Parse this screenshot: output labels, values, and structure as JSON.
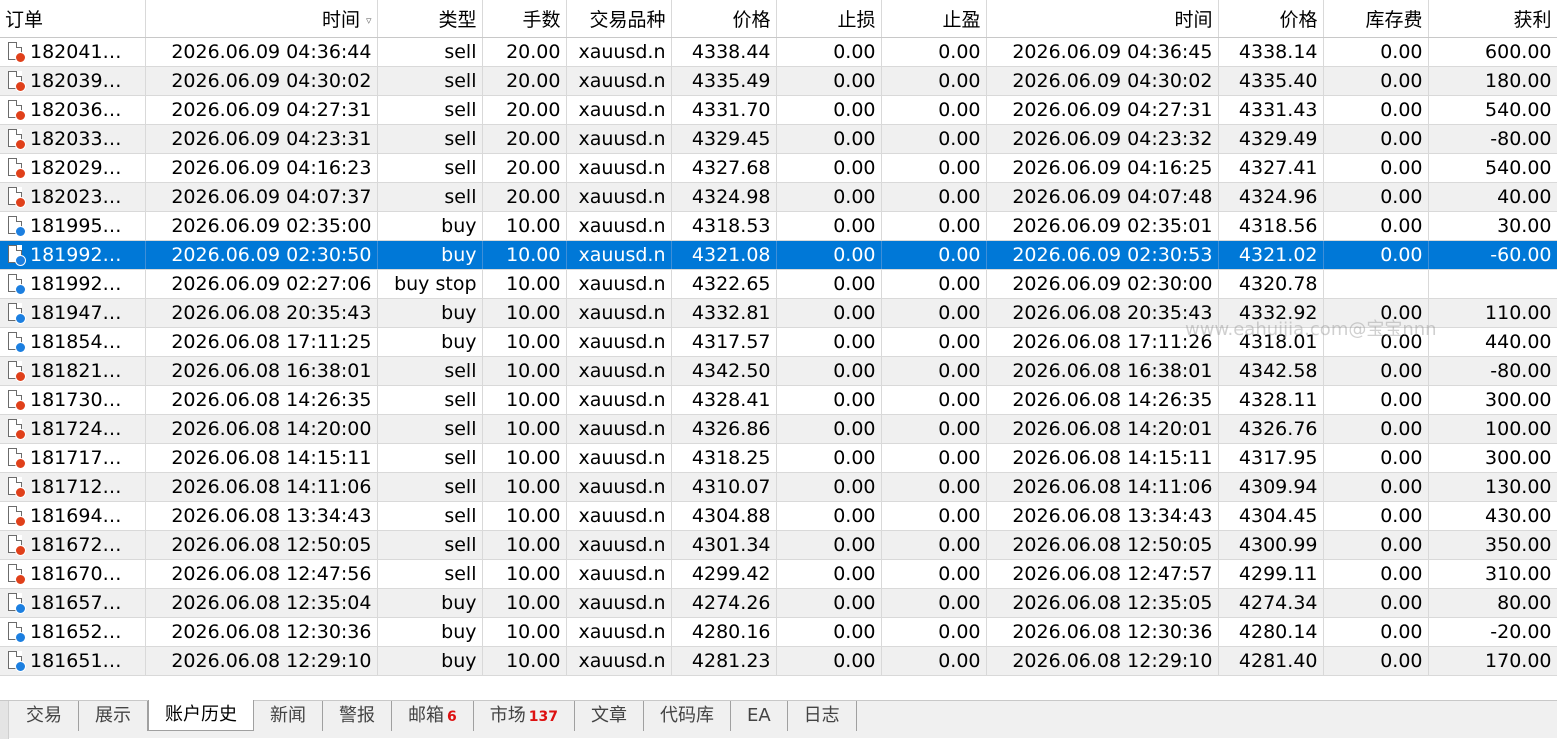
{
  "headers": {
    "order": "订单",
    "open_time": "时间",
    "type": "类型",
    "volume": "手数",
    "symbol": "交易品种",
    "open_price": "价格",
    "sl": "止损",
    "tp": "止盈",
    "close_time": "时间",
    "close_price": "价格",
    "swap": "库存费",
    "profit": "获利"
  },
  "rows": [
    {
      "order": "182041…",
      "open_time": "2026.06.09 04:36:44",
      "type": "sell",
      "volume": "20.00",
      "symbol": "xauusd.n",
      "open_price": "4338.44",
      "sl": "0.00",
      "tp": "0.00",
      "close_time": "2026.06.09 04:36:45",
      "close_price": "4338.14",
      "swap": "0.00",
      "profit": "600.00",
      "icon": "red"
    },
    {
      "order": "182039…",
      "open_time": "2026.06.09 04:30:02",
      "type": "sell",
      "volume": "20.00",
      "symbol": "xauusd.n",
      "open_price": "4335.49",
      "sl": "0.00",
      "tp": "0.00",
      "close_time": "2026.06.09 04:30:02",
      "close_price": "4335.40",
      "swap": "0.00",
      "profit": "180.00",
      "icon": "red"
    },
    {
      "order": "182036…",
      "open_time": "2026.06.09 04:27:31",
      "type": "sell",
      "volume": "20.00",
      "symbol": "xauusd.n",
      "open_price": "4331.70",
      "sl": "0.00",
      "tp": "0.00",
      "close_time": "2026.06.09 04:27:31",
      "close_price": "4331.43",
      "swap": "0.00",
      "profit": "540.00",
      "icon": "red"
    },
    {
      "order": "182033…",
      "open_time": "2026.06.09 04:23:31",
      "type": "sell",
      "volume": "20.00",
      "symbol": "xauusd.n",
      "open_price": "4329.45",
      "sl": "0.00",
      "tp": "0.00",
      "close_time": "2026.06.09 04:23:32",
      "close_price": "4329.49",
      "swap": "0.00",
      "profit": "-80.00",
      "icon": "red"
    },
    {
      "order": "182029…",
      "open_time": "2026.06.09 04:16:23",
      "type": "sell",
      "volume": "20.00",
      "symbol": "xauusd.n",
      "open_price": "4327.68",
      "sl": "0.00",
      "tp": "0.00",
      "close_time": "2026.06.09 04:16:25",
      "close_price": "4327.41",
      "swap": "0.00",
      "profit": "540.00",
      "icon": "red"
    },
    {
      "order": "182023…",
      "open_time": "2026.06.09 04:07:37",
      "type": "sell",
      "volume": "20.00",
      "symbol": "xauusd.n",
      "open_price": "4324.98",
      "sl": "0.00",
      "tp": "0.00",
      "close_time": "2026.06.09 04:07:48",
      "close_price": "4324.96",
      "swap": "0.00",
      "profit": "40.00",
      "icon": "red"
    },
    {
      "order": "181995…",
      "open_time": "2026.06.09 02:35:00",
      "type": "buy",
      "volume": "10.00",
      "symbol": "xauusd.n",
      "open_price": "4318.53",
      "sl": "0.00",
      "tp": "0.00",
      "close_time": "2026.06.09 02:35:01",
      "close_price": "4318.56",
      "swap": "0.00",
      "profit": "30.00",
      "icon": "blue"
    },
    {
      "order": "181992…",
      "open_time": "2026.06.09 02:30:50",
      "type": "buy",
      "volume": "10.00",
      "symbol": "xauusd.n",
      "open_price": "4321.08",
      "sl": "0.00",
      "tp": "0.00",
      "close_time": "2026.06.09 02:30:53",
      "close_price": "4321.02",
      "swap": "0.00",
      "profit": "-60.00",
      "icon": "blue",
      "selected": true
    },
    {
      "order": "181992…",
      "open_time": "2026.06.09 02:27:06",
      "type": "buy stop",
      "volume": "10.00",
      "symbol": "xauusd.n",
      "open_price": "4322.65",
      "sl": "0.00",
      "tp": "0.00",
      "close_time": "2026.06.09 02:30:00",
      "close_price": "4320.78",
      "swap": "",
      "profit": "",
      "icon": "blue"
    },
    {
      "order": "181947…",
      "open_time": "2026.06.08 20:35:43",
      "type": "buy",
      "volume": "10.00",
      "symbol": "xauusd.n",
      "open_price": "4332.81",
      "sl": "0.00",
      "tp": "0.00",
      "close_time": "2026.06.08 20:35:43",
      "close_price": "4332.92",
      "swap": "0.00",
      "profit": "110.00",
      "icon": "blue"
    },
    {
      "order": "181854…",
      "open_time": "2026.06.08 17:11:25",
      "type": "buy",
      "volume": "10.00",
      "symbol": "xauusd.n",
      "open_price": "4317.57",
      "sl": "0.00",
      "tp": "0.00",
      "close_time": "2026.06.08 17:11:26",
      "close_price": "4318.01",
      "swap": "0.00",
      "profit": "440.00",
      "icon": "blue"
    },
    {
      "order": "181821…",
      "open_time": "2026.06.08 16:38:01",
      "type": "sell",
      "volume": "10.00",
      "symbol": "xauusd.n",
      "open_price": "4342.50",
      "sl": "0.00",
      "tp": "0.00",
      "close_time": "2026.06.08 16:38:01",
      "close_price": "4342.58",
      "swap": "0.00",
      "profit": "-80.00",
      "icon": "red"
    },
    {
      "order": "181730…",
      "open_time": "2026.06.08 14:26:35",
      "type": "sell",
      "volume": "10.00",
      "symbol": "xauusd.n",
      "open_price": "4328.41",
      "sl": "0.00",
      "tp": "0.00",
      "close_time": "2026.06.08 14:26:35",
      "close_price": "4328.11",
      "swap": "0.00",
      "profit": "300.00",
      "icon": "red"
    },
    {
      "order": "181724…",
      "open_time": "2026.06.08 14:20:00",
      "type": "sell",
      "volume": "10.00",
      "symbol": "xauusd.n",
      "open_price": "4326.86",
      "sl": "0.00",
      "tp": "0.00",
      "close_time": "2026.06.08 14:20:01",
      "close_price": "4326.76",
      "swap": "0.00",
      "profit": "100.00",
      "icon": "red"
    },
    {
      "order": "181717…",
      "open_time": "2026.06.08 14:15:11",
      "type": "sell",
      "volume": "10.00",
      "symbol": "xauusd.n",
      "open_price": "4318.25",
      "sl": "0.00",
      "tp": "0.00",
      "close_time": "2026.06.08 14:15:11",
      "close_price": "4317.95",
      "swap": "0.00",
      "profit": "300.00",
      "icon": "red"
    },
    {
      "order": "181712…",
      "open_time": "2026.06.08 14:11:06",
      "type": "sell",
      "volume": "10.00",
      "symbol": "xauusd.n",
      "open_price": "4310.07",
      "sl": "0.00",
      "tp": "0.00",
      "close_time": "2026.06.08 14:11:06",
      "close_price": "4309.94",
      "swap": "0.00",
      "profit": "130.00",
      "icon": "red"
    },
    {
      "order": "181694…",
      "open_time": "2026.06.08 13:34:43",
      "type": "sell",
      "volume": "10.00",
      "symbol": "xauusd.n",
      "open_price": "4304.88",
      "sl": "0.00",
      "tp": "0.00",
      "close_time": "2026.06.08 13:34:43",
      "close_price": "4304.45",
      "swap": "0.00",
      "profit": "430.00",
      "icon": "red"
    },
    {
      "order": "181672…",
      "open_time": "2026.06.08 12:50:05",
      "type": "sell",
      "volume": "10.00",
      "symbol": "xauusd.n",
      "open_price": "4301.34",
      "sl": "0.00",
      "tp": "0.00",
      "close_time": "2026.06.08 12:50:05",
      "close_price": "4300.99",
      "swap": "0.00",
      "profit": "350.00",
      "icon": "red"
    },
    {
      "order": "181670…",
      "open_time": "2026.06.08 12:47:56",
      "type": "sell",
      "volume": "10.00",
      "symbol": "xauusd.n",
      "open_price": "4299.42",
      "sl": "0.00",
      "tp": "0.00",
      "close_time": "2026.06.08 12:47:57",
      "close_price": "4299.11",
      "swap": "0.00",
      "profit": "310.00",
      "icon": "red"
    },
    {
      "order": "181657…",
      "open_time": "2026.06.08 12:35:04",
      "type": "buy",
      "volume": "10.00",
      "symbol": "xauusd.n",
      "open_price": "4274.26",
      "sl": "0.00",
      "tp": "0.00",
      "close_time": "2026.06.08 12:35:05",
      "close_price": "4274.34",
      "swap": "0.00",
      "profit": "80.00",
      "icon": "blue"
    },
    {
      "order": "181652…",
      "open_time": "2026.06.08 12:30:36",
      "type": "buy",
      "volume": "10.00",
      "symbol": "xauusd.n",
      "open_price": "4280.16",
      "sl": "0.00",
      "tp": "0.00",
      "close_time": "2026.06.08 12:30:36",
      "close_price": "4280.14",
      "swap": "0.00",
      "profit": "-20.00",
      "icon": "blue"
    },
    {
      "order": "181651…",
      "open_time": "2026.06.08 12:29:10",
      "type": "buy",
      "volume": "10.00",
      "symbol": "xauusd.n",
      "open_price": "4281.23",
      "sl": "0.00",
      "tp": "0.00",
      "close_time": "2026.06.08 12:29:10",
      "close_price": "4281.40",
      "swap": "0.00",
      "profit": "170.00",
      "icon": "blue"
    }
  ],
  "watermark": "www.eahuijia.com@宝宝nnn",
  "tabs": [
    {
      "label": "交易",
      "badge": ""
    },
    {
      "label": "展示",
      "badge": ""
    },
    {
      "label": "账户历史",
      "badge": "",
      "active": true
    },
    {
      "label": "新闻",
      "badge": ""
    },
    {
      "label": "警报",
      "badge": ""
    },
    {
      "label": "邮箱",
      "badge": "6"
    },
    {
      "label": "市场",
      "badge": "137"
    },
    {
      "label": "文章",
      "badge": ""
    },
    {
      "label": "代码库",
      "badge": ""
    },
    {
      "label": "EA",
      "badge": ""
    },
    {
      "label": "日志",
      "badge": ""
    }
  ],
  "colors": {
    "selection": "#0078d7",
    "sell_icon_dot": "#e0401a",
    "buy_icon_dot": "#1c7fe0",
    "badge": "#dd1111"
  }
}
